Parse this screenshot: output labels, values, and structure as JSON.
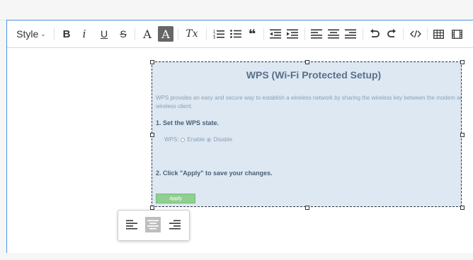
{
  "toolbar": {
    "style_label": "Style",
    "buttons": {
      "bold": "B",
      "italic": "i",
      "underline": "U",
      "strike": "S",
      "text_color": "A",
      "bg_color": "A",
      "clear_format": "Tx",
      "quote": "❝"
    }
  },
  "embed": {
    "title": "WPS (Wi-Fi Protected Setup)",
    "description": "WPS provides an easy and secure way to establish a wireless network by sharing the wireless key between the modem and wireless client.",
    "step1": "1. Set the WPS state.",
    "wps_label": "WPS:",
    "enable_label": "Enable",
    "disable_label": "Disable",
    "selected": "Disable",
    "step2": "2. Click \"Apply\" to save your changes.",
    "apply_label": "Apply"
  },
  "image_align": {
    "selected": "center"
  },
  "colors": {
    "editor_border": "#4a90e2",
    "embed_bg": "#dde8f3",
    "apply_bg": "#8fcf8f",
    "title_color": "#58708b"
  }
}
